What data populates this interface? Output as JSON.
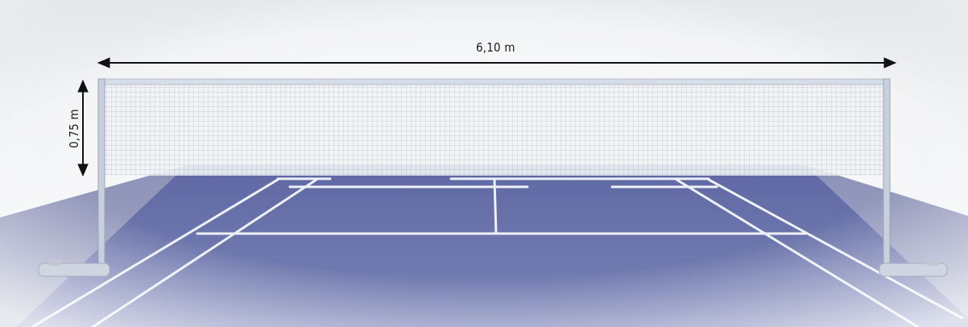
{
  "dimensions": {
    "net_width": "6,10 m",
    "net_height": "0,75 m"
  },
  "colors": {
    "court": "#6f78ad",
    "court_lines": "#eef1f8",
    "posts": "#c8d0de",
    "net_mesh": "#b8c0cc",
    "tape": "#d6dde8",
    "arrows": "#111111"
  }
}
